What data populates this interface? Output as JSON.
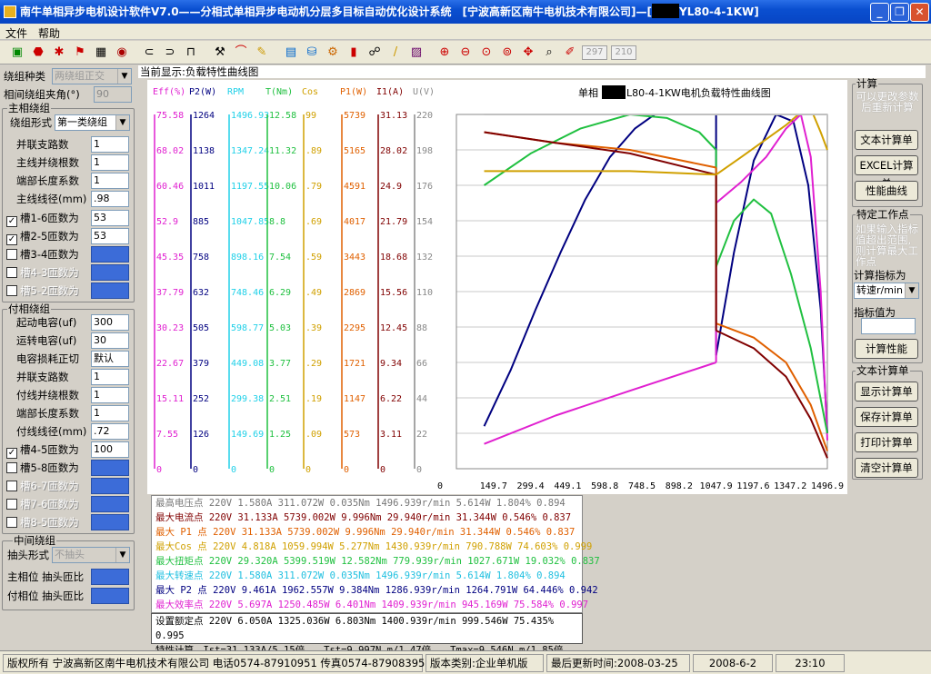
{
  "window": {
    "title_left": "南牛单相异步电机设计软件V7.0——分相式单相异步电动机分层多目标自动优化设计系统　[宁波高新区南牛电机技术有限公司]—[",
    "title_model": "YL80-4-1KW]"
  },
  "menu": [
    "文件",
    "帮助"
  ],
  "toolbar": {
    "box1": "297",
    "box2": "210"
  },
  "left": {
    "winding_type_label": "绕组种类",
    "winding_type_value": "两绕组正交",
    "phase_angle_label": "相间绕组夹角(°)",
    "phase_angle_value": "90",
    "main_group": "主相绕组",
    "main_form_label": "绕组形式",
    "main_form_value": "第一类绕组",
    "main_rows": [
      {
        "label": "并联支路数",
        "value": "1"
      },
      {
        "label": "主线并绕根数",
        "value": "1"
      },
      {
        "label": "端部长度系数",
        "value": "1"
      },
      {
        "label": "主线线径(mm)",
        "value": ".98"
      }
    ],
    "main_checks": [
      {
        "label": "槽1-6匝数为",
        "value": "53",
        "checked": "✓"
      },
      {
        "label": "槽2-5匝数为",
        "value": "53",
        "checked": "✓"
      },
      {
        "label": "槽3-4匝数为",
        "value": "",
        "checked": ""
      },
      {
        "label": "槽4-3匝数为",
        "value": "",
        "checked": ""
      },
      {
        "label": "槽5-2匝数为",
        "value": "",
        "checked": ""
      }
    ],
    "aux_group": "付相绕组",
    "aux_rows": [
      {
        "label": "起动电容(uf)",
        "value": "300"
      },
      {
        "label": "运转电容(uf)",
        "value": "30"
      },
      {
        "label": "电容损耗正切",
        "value": "默认"
      },
      {
        "label": "并联支路数",
        "value": "1"
      },
      {
        "label": "付线并绕根数",
        "value": "1"
      },
      {
        "label": "端部长度系数",
        "value": "1"
      },
      {
        "label": "付线线径(mm)",
        "value": ".72"
      }
    ],
    "aux_checks": [
      {
        "label": "槽4-5匝数为",
        "value": "100",
        "checked": "✓"
      },
      {
        "label": "槽5-8匝数为",
        "value": "",
        "checked": ""
      },
      {
        "label": "槽6-7匝数为",
        "value": "",
        "checked": ""
      },
      {
        "label": "槽7-6匝数为",
        "value": "",
        "checked": ""
      },
      {
        "label": "槽8-5匝数为",
        "value": "",
        "checked": ""
      }
    ],
    "tap_group": "中间绕组",
    "tap_form_label": "抽头形式",
    "tap_form_value": "不抽头",
    "main_tap_label": "主相位 抽头匝比",
    "aux_tap_label": "付相位 抽头匝比"
  },
  "current_display": "当前显示:负载特性曲线图",
  "chart_data": {
    "type": "line",
    "title_prefix": "单相",
    "title_suffix": "L80-4-1KW电机负载特性曲线图",
    "xlabel": "RPM",
    "x_ticks": [
      "0",
      "149.7",
      "299.4",
      "449.1",
      "598.8",
      "748.5",
      "898.2",
      "1047.9",
      "1197.6",
      "1347.2",
      "1496.9"
    ],
    "y_axes": [
      {
        "name": "Eff(%)",
        "color": "#e020d0",
        "ticks": [
          "75.58",
          "68.02",
          "60.46",
          "52.9",
          "45.35",
          "37.79",
          "30.23",
          "22.67",
          "15.11",
          "7.55",
          "0"
        ]
      },
      {
        "name": "P2(W)",
        "color": "#000080",
        "ticks": [
          "1264",
          "1138",
          "1011",
          "885",
          "758",
          "632",
          "505",
          "379",
          "252",
          "126",
          "0"
        ]
      },
      {
        "name": "RPM",
        "color": "#20d0e8",
        "ticks": [
          "1496.93",
          "1347.24",
          "1197.55",
          "1047.85",
          "898.16",
          "748.46",
          "598.77",
          "449.08",
          "299.38",
          "149.69",
          "0"
        ]
      },
      {
        "name": "T(Nm)",
        "color": "#20c040",
        "ticks": [
          "12.58",
          "11.32",
          "10.06",
          "8.8",
          "7.54",
          "6.29",
          "5.03",
          "3.77",
          "2.51",
          "1.25",
          "0"
        ]
      },
      {
        "name": "Cos",
        "color": "#d0a000",
        "ticks": [
          "99",
          ".89",
          ".79",
          ".69",
          ".59",
          ".49",
          ".39",
          ".29",
          ".19",
          ".09",
          "0"
        ]
      },
      {
        "name": "P1(W)",
        "color": "#e06000",
        "ticks": [
          "5739",
          "5165",
          "4591",
          "4017",
          "3443",
          "2869",
          "2295",
          "1721",
          "1147",
          "573",
          "0"
        ]
      },
      {
        "name": "I1(A)",
        "color": "#800000",
        "ticks": [
          "31.13",
          "28.02",
          "24.9",
          "21.79",
          "18.68",
          "15.56",
          "12.45",
          "9.34",
          "6.22",
          "3.11",
          "0"
        ]
      },
      {
        "name": "U(V)",
        "color": "#888888",
        "ticks": [
          "220",
          "198",
          "176",
          "154",
          "132",
          "110",
          "88",
          "66",
          "44",
          "22",
          "0"
        ]
      }
    ],
    "series": [
      {
        "color": "#000080",
        "points": [
          [
            112,
            0.88
          ],
          [
            220,
            0.72
          ],
          [
            320,
            0.55
          ],
          [
            420,
            0.39
          ],
          [
            520,
            0.24
          ],
          [
            620,
            0.12
          ],
          [
            720,
            0.04
          ],
          [
            800,
            0.0
          ],
          [
            1047.9,
            0.0
          ]
        ],
        "seg2": [
          [
            1047.9,
            0.68
          ],
          [
            1120,
            0.39
          ],
          [
            1200,
            0.13
          ],
          [
            1290,
            0.0
          ],
          [
            1360,
            0.02
          ],
          [
            1420,
            0.2
          ],
          [
            1470,
            0.55
          ],
          [
            1496.9,
            0.9
          ]
        ]
      },
      {
        "color": "#e020d0",
        "points": [
          [
            112,
            0.93
          ],
          [
            400,
            0.85
          ],
          [
            700,
            0.78
          ],
          [
            1047.9,
            0.7
          ]
        ],
        "seg2": [
          [
            1047.9,
            0.25
          ],
          [
            1150,
            0.19
          ],
          [
            1250,
            0.12
          ],
          [
            1330,
            0.04
          ],
          [
            1390,
            0.0
          ],
          [
            1430,
            0.12
          ],
          [
            1470,
            0.5
          ],
          [
            1496.9,
            0.92
          ]
        ]
      },
      {
        "color": "#20c040",
        "points": [
          [
            112,
            0.2
          ],
          [
            300,
            0.11
          ],
          [
            500,
            0.04
          ],
          [
            700,
            0.0
          ],
          [
            850,
            0.01
          ],
          [
            980,
            0.05
          ],
          [
            1047.9,
            0.1
          ]
        ],
        "seg2": [
          [
            1047.9,
            0.43
          ],
          [
            1120,
            0.3
          ],
          [
            1200,
            0.24
          ],
          [
            1270,
            0.28
          ],
          [
            1350,
            0.45
          ],
          [
            1430,
            0.66
          ],
          [
            1496.9,
            0.9
          ]
        ]
      },
      {
        "color": "#e06000",
        "points": [
          [
            112,
            0.05
          ],
          [
            400,
            0.08
          ],
          [
            700,
            0.1
          ],
          [
            1047.9,
            0.15
          ]
        ],
        "seg2": [
          [
            1047.9,
            0.59
          ],
          [
            1200,
            0.63
          ],
          [
            1330,
            0.7
          ],
          [
            1430,
            0.82
          ],
          [
            1496.9,
            0.95
          ]
        ]
      },
      {
        "color": "#800000",
        "points": [
          [
            112,
            0.05
          ],
          [
            400,
            0.08
          ],
          [
            700,
            0.11
          ],
          [
            1047.9,
            0.17
          ]
        ],
        "seg2": [
          [
            1047.9,
            0.61
          ],
          [
            1200,
            0.66
          ],
          [
            1330,
            0.74
          ],
          [
            1430,
            0.86
          ],
          [
            1496.9,
            0.97
          ]
        ]
      },
      {
        "color": "#d0a000",
        "points": [
          [
            112,
            0.16
          ],
          [
            400,
            0.16
          ],
          [
            700,
            0.16
          ],
          [
            1047.9,
            0.17
          ]
        ],
        "seg2": [
          [
            1047.9,
            0.17
          ],
          [
            1150,
            0.12
          ],
          [
            1250,
            0.07
          ],
          [
            1330,
            0.03
          ],
          [
            1380,
            0.0
          ],
          [
            1440,
            0.0
          ],
          [
            1470,
            0.05
          ],
          [
            1496.9,
            0.1
          ]
        ]
      },
      {
        "color": "#c0c0c0",
        "points": [
          [
            112,
            0.0
          ],
          [
            1496.9,
            0.0
          ]
        ],
        "seg2": []
      }
    ]
  },
  "info_lines": [
    {
      "text": "最高电压点 220V 1.580A 311.072W 0.035Nm 1496.939r/min 5.614W 1.804% 0.894",
      "color": "#777777"
    },
    {
      "text": "最大电流点 220V 31.133A 5739.002W 9.996Nm 29.940r/min 31.344W 0.546% 0.837",
      "color": "#800000"
    },
    {
      "text": "最大 P1 点 220V 31.133A 5739.002W 9.996Nm 29.940r/min 31.344W 0.546% 0.837",
      "color": "#e06000"
    },
    {
      "text": "最大Cos 点 220V 4.818A 1059.994W 5.277Nm 1430.939r/min 790.788W 74.603% 0.999",
      "color": "#d0a000"
    },
    {
      "text": "最大扭矩点 220V 29.320A 5399.519W 12.582Nm 779.939r/min 1027.671W 19.032% 0.837",
      "color": "#20c040"
    },
    {
      "text": "最大转速点 220V 1.580A 311.072W 0.035Nm 1496.939r/min 5.614W 1.804% 0.894",
      "color": "#20c0e0"
    },
    {
      "text": "最大 P2 点 220V 9.461A 1962.557W 9.384Nm 1286.939r/min 1264.791W 64.446% 0.942",
      "color": "#000080"
    },
    {
      "text": "最大效率点 220V 5.697A 1250.485W 6.401Nm 1409.939r/min 945.169W 75.584% 0.997",
      "color": "#e020d0"
    }
  ],
  "rated": {
    "line1": "设置额定点 220V 6.050A 1325.036W 6.803Nm 1400.939r/min 999.546W 75.435% 0.995",
    "line2": "特性计算　Ist=31.133A/5.15倍　　Tst=9.997N.m/1.47倍　　Tmax=9.546N.m/1.85倍"
  },
  "right": {
    "calc_group": "计算",
    "calc_note": "可以更改参数后重新计算",
    "btn_text_calc": "文本计算单",
    "btn_excel_calc": "EXCEL计算单",
    "btn_perf_curve": "性能曲线",
    "spec_group": "特定工作点",
    "spec_note": "如果输入指标值超出范围,则计算最大工作点",
    "target_label": "计算指标为",
    "target_value": "转速r/min",
    "target_val_label": "指标值为",
    "target_val_value": "",
    "btn_calc_perf": "计算性能",
    "text_group": "文本计算单",
    "btn_show": "显示计算单",
    "btn_save": "保存计算单",
    "btn_print": "打印计算单",
    "btn_clear": "清空计算单"
  },
  "status": {
    "copyright": "版权所有  宁波高新区南牛电机技术有限公司  电话0574-87910951  传真0574-87908395",
    "edition": "版本类别:企业单机版",
    "updated": "最后更新时间:2008-03-25",
    "date": "2008-6-2",
    "time": "23:10"
  }
}
